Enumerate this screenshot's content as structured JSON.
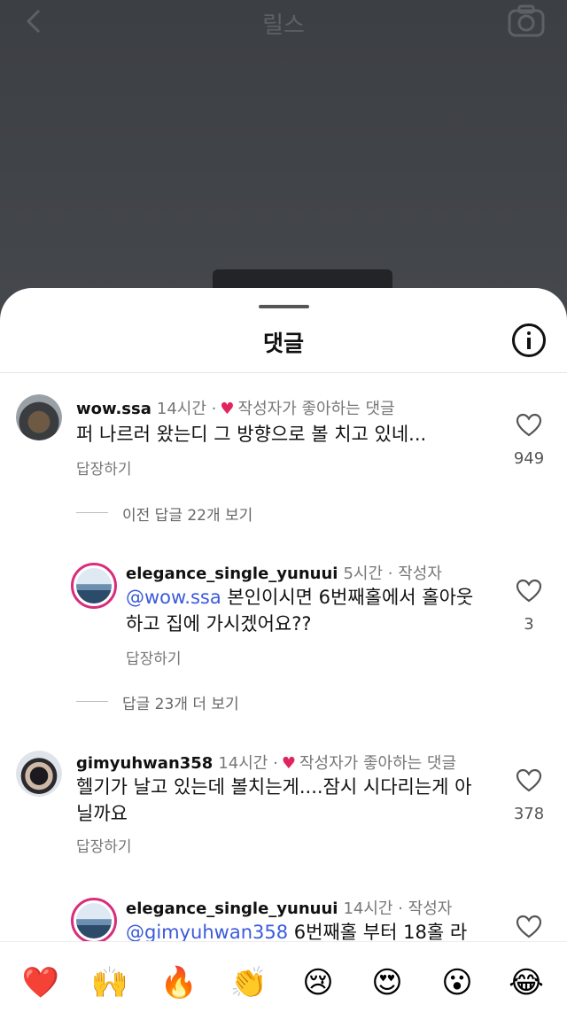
{
  "background": {
    "title": "릴스",
    "back_icon": "chevron-left-icon",
    "camera_icon": "camera-icon"
  },
  "sheet": {
    "title": "댓글",
    "info_icon": "info-icon"
  },
  "comments": [
    {
      "username": "wow.ssa",
      "time": "14시간",
      "separator": "·",
      "badge": "작성자가 좋아하는 댓글",
      "text": "퍼 나르러 왔는디 그 방향으로 볼 치고 있네...",
      "reply_label": "답장하기",
      "like_count": "949"
    }
  ],
  "view_prev": "이전 답글 22개 보기",
  "replies1": [
    {
      "username": "elegance_single_yunuui",
      "time": "5시간",
      "separator": "·",
      "author_tag": "작성자",
      "mention": "@wow.ssa",
      "text_line1": " 본인이시면 6번째홀에서 홀아웃",
      "text_line2": "하고 집에 가시겠어요??",
      "reply_label": "답장하기",
      "like_count": "3"
    }
  ],
  "view_more": "답글 23개 더 보기",
  "comment2": {
    "username": "gimyuhwan358",
    "time": "14시간",
    "separator": "·",
    "badge": "작성자가 좋아하는 댓글",
    "text_line1": "헬기가 날고 있는데 볼치는게....잠시 시다리는게 아",
    "text_line2": "닐까요",
    "reply_label": "답장하기",
    "like_count": "378"
  },
  "reply2": {
    "username": "elegance_single_yunuui",
    "time": "14시간",
    "separator": "·",
    "author_tag": "작성자",
    "mention": "@gimyuhwan358",
    "text_line1": " 6번째홀 부터 18홀 라"
  },
  "emojis": [
    {
      "name": "red-heart-emoji",
      "char": "❤️"
    },
    {
      "name": "raising-hands-emoji",
      "char": "🙌"
    },
    {
      "name": "fire-emoji",
      "char": "🔥"
    },
    {
      "name": "clapping-hands-emoji",
      "char": "👏"
    },
    {
      "name": "crying-face-emoji",
      "char": "😢"
    },
    {
      "name": "heart-eyes-emoji",
      "char": "😍"
    },
    {
      "name": "surprised-face-emoji",
      "char": "😮"
    },
    {
      "name": "tears-of-joy-emoji",
      "char": "😂"
    }
  ],
  "colors": {
    "mention": "#3b5bdb",
    "heart": "#e0245e",
    "story_ring": "#d82d7e"
  }
}
